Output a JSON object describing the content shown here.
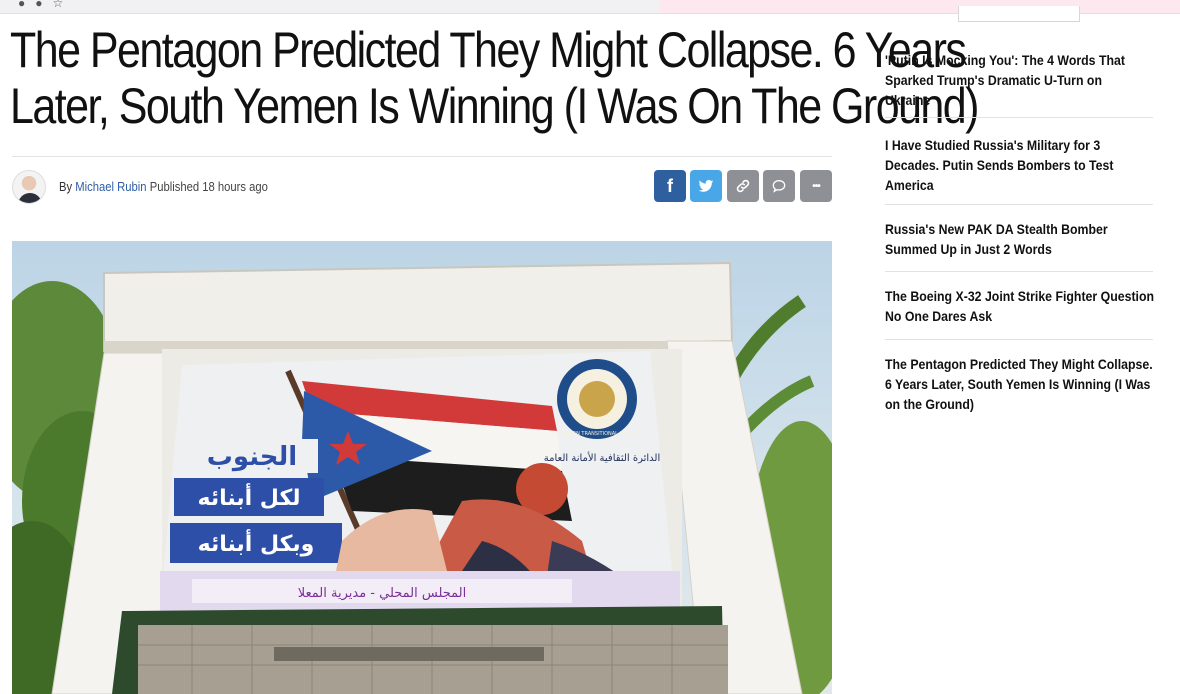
{
  "article": {
    "headline_line1": "The Pentagon Predicted They Might Collapse. 6 Years",
    "headline_line2": "Later, South Yemen Is Winning (I Was On The Ground)",
    "by_prefix": "By",
    "author": "Michael Rubin",
    "published_label": "Published",
    "published_time": "18 hours ago"
  },
  "share": {
    "facebook": "f",
    "twitter_icon": "twitter-bird-icon",
    "link_icon": "link-icon",
    "comment_icon": "comment-icon",
    "more": "•••"
  },
  "sidebar": {
    "items": [
      {
        "title": "'Putin Is Mocking You': The 4 Words That Sparked Trump's Dramatic U-Turn on Ukraine"
      },
      {
        "title": "I Have Studied Russia's Military for 3 Decades. Putin Sends Bombers to Test America"
      },
      {
        "title": "Russia's New PAK DA Stealth Bomber Summed Up in Just 2 Words"
      },
      {
        "title": "The Boeing X-32 Joint Strike Fighter Question No One Dares Ask"
      },
      {
        "title": "The Pentagon Predicted They Might Collapse. 6 Years Later, South Yemen Is Winning (I Was on the Ground)"
      }
    ]
  },
  "image": {
    "mural_text_1": "الجنوب",
    "mural_text_2": "لكل أبنائه",
    "mural_text_3": "وبكل أبنائه",
    "mural_text_4": "المجلس المحلي - مديرية المعلا",
    "emblem_text": "الدائرة الثقافية الأمانة العامة",
    "emblem_ring": "SOUTHERN TRANSITIONAL COUNCIL"
  },
  "colors": {
    "author_link": "#2f5ea6",
    "facebook": "#2e5f9f",
    "twitter": "#49a7e8",
    "share_gray": "#8e9096"
  }
}
